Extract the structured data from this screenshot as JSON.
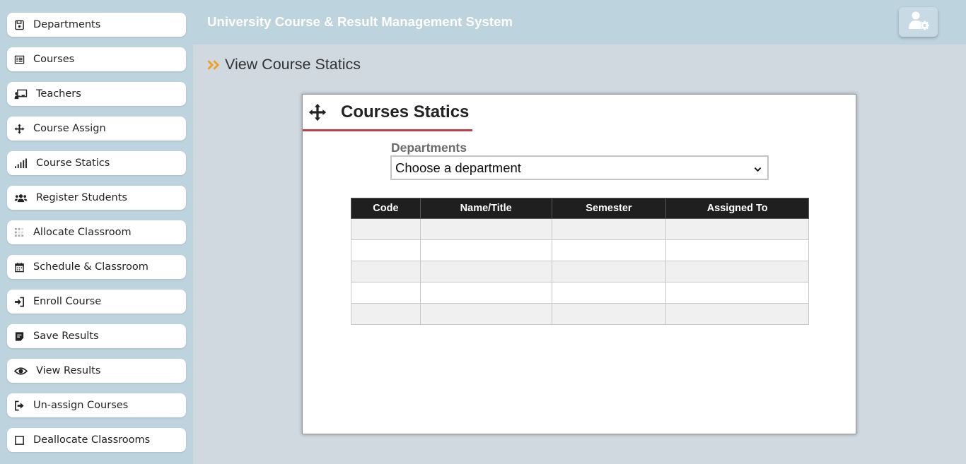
{
  "app": {
    "title": "University Course & Result Management System"
  },
  "sidebar": {
    "items": [
      {
        "label": "Departments",
        "icon": "save-icon"
      },
      {
        "label": "Courses",
        "icon": "list-icon"
      },
      {
        "label": "Teachers",
        "icon": "chalkboard-teacher-icon"
      },
      {
        "label": "Course Assign",
        "icon": "arrows-move-icon"
      },
      {
        "label": "Course Statics",
        "icon": "signal-bars-icon"
      },
      {
        "label": "Register Students",
        "icon": "users-icon"
      },
      {
        "label": "Allocate Classroom",
        "icon": "grid-icon"
      },
      {
        "label": "Schedule & Classroom",
        "icon": "calendar-icon"
      },
      {
        "label": "Enroll Course",
        "icon": "sign-in-icon"
      },
      {
        "label": "Save Results",
        "icon": "file-icon"
      },
      {
        "label": "View Results",
        "icon": "eye-icon"
      },
      {
        "label": "Un-assign Courses",
        "icon": "sign-out-icon"
      },
      {
        "label": "Deallocate Classrooms",
        "icon": "square-icon"
      }
    ]
  },
  "header": {
    "user_icon": "user-cog-icon"
  },
  "page": {
    "heading": "View Course Statics",
    "heading_icon": "double-chevron-right-icon",
    "accent_color": "#f0a020"
  },
  "card": {
    "title": "Courses Statics",
    "title_icon": "arrows-move-icon",
    "underline_color": "#b8414a",
    "department_label": "Departments",
    "department_select_value": "Choose a department",
    "table": {
      "columns": [
        "Code",
        "Name/Title",
        "Semester",
        "Assigned To"
      ],
      "rows": [
        [
          "",
          "",
          "",
          ""
        ],
        [
          "",
          "",
          "",
          ""
        ],
        [
          "",
          "",
          "",
          ""
        ],
        [
          "",
          "",
          "",
          ""
        ],
        [
          "",
          "",
          "",
          ""
        ]
      ]
    }
  }
}
